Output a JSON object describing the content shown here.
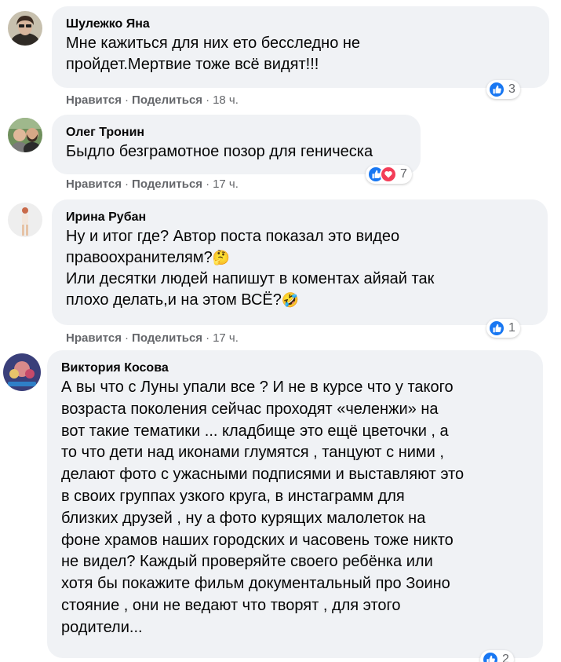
{
  "colors": {
    "bubble_bg": "#f0f2f5",
    "meta_text": "#65676b",
    "like_blue": "#1877f2",
    "love_red": "#f33e58"
  },
  "comments": [
    {
      "author": "Шулежко Яна",
      "lines": [
        "Мне кажиться для них ето бесследно не",
        "пройдет.Мертвие тоже всё видят!!!"
      ],
      "like_label": "Нравится",
      "share_label": "Поделиться",
      "time": "18 ч.",
      "reactions": [
        "like-icon"
      ],
      "reaction_count": "3"
    },
    {
      "author": "Олег Тронин",
      "lines": [
        "Быдло безграмотное позор для геническа"
      ],
      "like_label": "Нравится",
      "share_label": "Поделиться",
      "time": "17 ч.",
      "reactions": [
        "like-icon",
        "love-icon"
      ],
      "reaction_count": "7"
    },
    {
      "author": "Ирина Рубан",
      "lines": [
        "Ну и итог где? Автор поста показал это видео",
        "правоохранителям?",
        "Или десятки людей напишут в коментах айяай так",
        "плохо делать,и на этом ВСЁ?"
      ],
      "emojis": [
        "🤔",
        "🤣"
      ],
      "like_label": "Нравится",
      "share_label": "Поделиться",
      "time": "17 ч.",
      "reactions": [
        "like-icon"
      ],
      "reaction_count": "1"
    },
    {
      "author": "Виктория Косова",
      "lines": [
        "А вы что с Луны упали все ? И не в курсе что у такого",
        "возраста поколения сейчас проходят «челенжи» на",
        "вот такие тематики ... кладбище это ещё цветочки , а",
        "то что дети над иконами глумятся , танцуют с ними ,",
        "делают фото с ужасными подписями и выставляют это",
        "в своих группах узкого круга, в инстаграмм для",
        "близких друзей , ну а фото курящих малолеток на",
        "фоне храмов наших городских и часовень тоже никто",
        "не видел? Каждый проверяйте своего ребёнка или",
        "хотя бы покажите фильм документальный про Зоино",
        "стояние , они не ведают что творят , для этого",
        "родители..."
      ],
      "reactions": [
        "like-icon"
      ],
      "reaction_count": "2"
    }
  ]
}
